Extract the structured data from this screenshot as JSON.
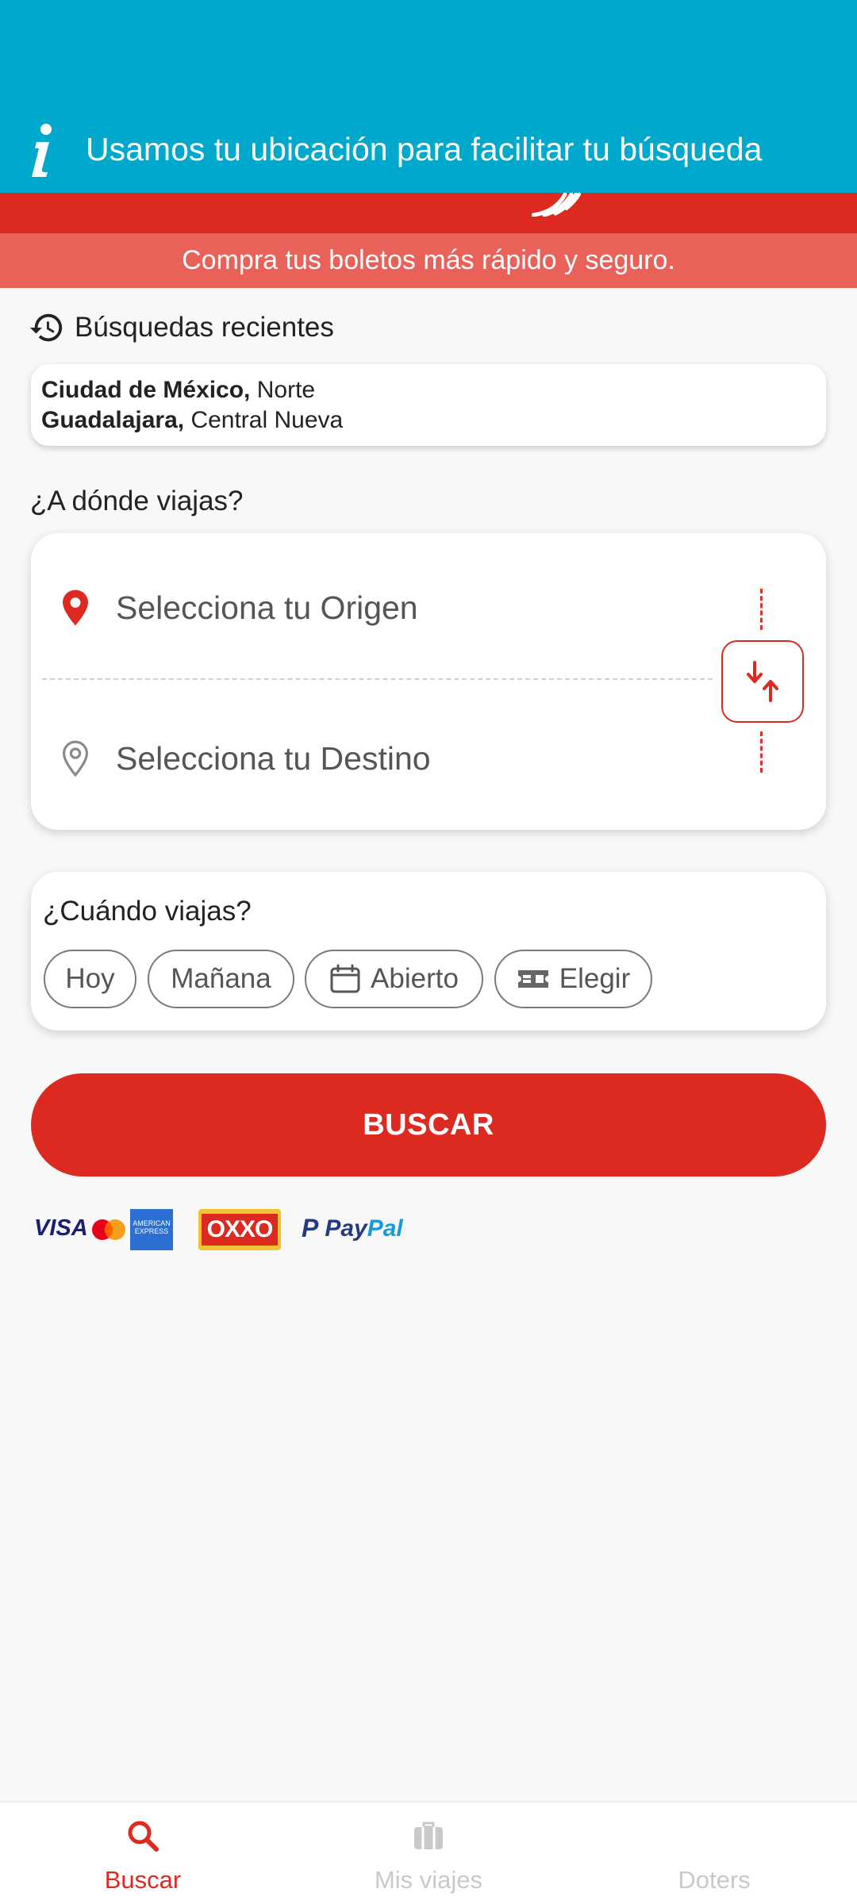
{
  "info_banner": {
    "text": "Usamos tu ubicación para facilitar tu búsqueda",
    "icon": "info-icon",
    "color": "#00a9cc"
  },
  "promo_bar": {
    "text": "Compra tus boletos más rápido y seguro."
  },
  "recent": {
    "title": "Búsquedas recientes",
    "icon": "history-icon",
    "items": [
      {
        "city": "Ciudad de México,",
        "terminal": "Norte"
      },
      {
        "city": "Guadalajara,",
        "terminal": "Central Nueva"
      }
    ]
  },
  "where": {
    "title": "¿A dónde viajas?",
    "origin_placeholder": "Selecciona tu Origen",
    "destination_placeholder": "Selecciona tu Destino"
  },
  "when": {
    "title": "¿Cuándo viajas?",
    "chips": [
      "Hoy",
      "Mañana",
      "Abierto",
      "Elegir"
    ]
  },
  "search_button": "BUSCAR",
  "payments": {
    "visa": "VISA",
    "amex_line1": "AMERICAN",
    "amex_line2": "EXPRESS",
    "oxxo": "OXXO",
    "paypal_pay": "Pay",
    "paypal_pal": "Pal"
  },
  "bottom_nav": [
    {
      "label": "Buscar",
      "icon": "search-icon",
      "active": true
    },
    {
      "label": "Mis viajes",
      "icon": "luggage-icon",
      "active": false
    },
    {
      "label": "Doters",
      "icon": "doters-icon",
      "active": false
    }
  ],
  "colors": {
    "brand_red": "#dd2a21",
    "promo_red": "#e8625a",
    "banner_blue": "#00a9cc"
  }
}
